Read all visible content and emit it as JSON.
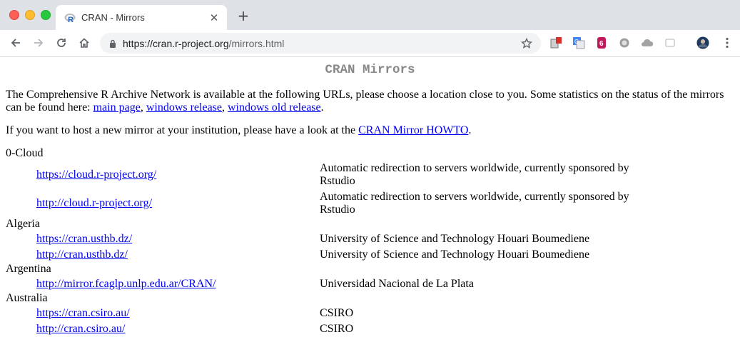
{
  "browser": {
    "tab_title": "CRAN - Mirrors",
    "tab_close": "✕",
    "new_tab": "+",
    "url_host": "https://cran.r-project.org",
    "url_path": "/mirrors.html",
    "extensions": [
      "pdf-icon",
      "translate-icon",
      "evernote-icon",
      "circle-icon",
      "cloud-icon",
      "blank-icon",
      "avatar"
    ]
  },
  "page": {
    "heading": "CRAN Mirrors",
    "intro_text": "The Comprehensive R Archive Network is available at the following URLs, please choose a location close to you. Some statistics on the status of the mirrors can be found here: ",
    "intro_links": [
      "main page",
      "windows release",
      "windows old release"
    ],
    "intro_sep": ", ",
    "intro_end": ".",
    "host_text": "If you want to host a new mirror at your institution, please have a look at the ",
    "host_link": "CRAN Mirror HOWTO",
    "host_end": "."
  },
  "mirrors": [
    {
      "country": "0-Cloud",
      "entries": [
        {
          "url": "https://cloud.r-project.org/",
          "desc": "Automatic redirection to servers worldwide, currently sponsored by Rstudio"
        },
        {
          "url": "http://cloud.r-project.org/",
          "desc": "Automatic redirection to servers worldwide, currently sponsored by Rstudio"
        }
      ]
    },
    {
      "country": "Algeria",
      "entries": [
        {
          "url": "https://cran.usthb.dz/",
          "desc": "University of Science and Technology Houari Boumediene"
        },
        {
          "url": "http://cran.usthb.dz/",
          "desc": "University of Science and Technology Houari Boumediene"
        }
      ]
    },
    {
      "country": "Argentina",
      "entries": [
        {
          "url": "http://mirror.fcaglp.unlp.edu.ar/CRAN/",
          "desc": "Universidad Nacional de La Plata"
        }
      ]
    },
    {
      "country": "Australia",
      "entries": [
        {
          "url": "https://cran.csiro.au/",
          "desc": "CSIRO"
        },
        {
          "url": "http://cran.csiro.au/",
          "desc": "CSIRO"
        }
      ]
    }
  ]
}
